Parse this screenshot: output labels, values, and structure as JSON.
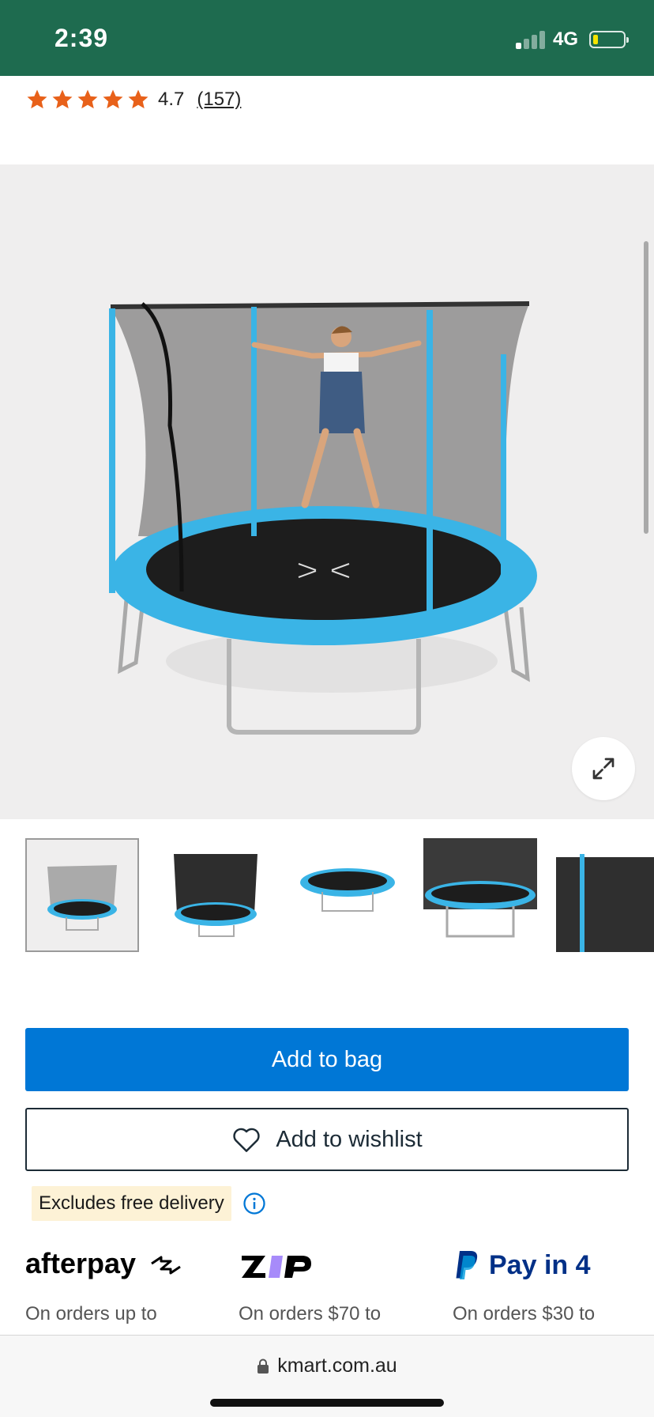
{
  "status_bar": {
    "time": "2:39",
    "network": "4G"
  },
  "rating": {
    "value": "4.7",
    "count": "(157)",
    "stars": 5,
    "star_color": "#e8611a"
  },
  "hero": {
    "image_alt": "Trampoline with safety net, girl jumping",
    "expand_icon": "expand-icon"
  },
  "gallery": {
    "thumbnail_count": 5,
    "selected_index": 0
  },
  "actions": {
    "add_to_bag": "Add to bag",
    "add_to_wishlist": "Add to wishlist"
  },
  "delivery": {
    "badge": "Excludes free delivery",
    "info_icon": "info-icon"
  },
  "payments": [
    {
      "brand": "afterpay",
      "text": "On orders up to"
    },
    {
      "brand": "zip",
      "text": "On orders $70 to"
    },
    {
      "brand": "paypal",
      "label": "Pay in 4",
      "text": "On orders $30 to"
    }
  ],
  "browser": {
    "url": "kmart.com.au"
  },
  "colors": {
    "status_bar": "#1e6b4f",
    "primary": "#0077d6",
    "trampoline_blue": "#3ab4e6",
    "badge_bg": "#fdf2d6"
  }
}
